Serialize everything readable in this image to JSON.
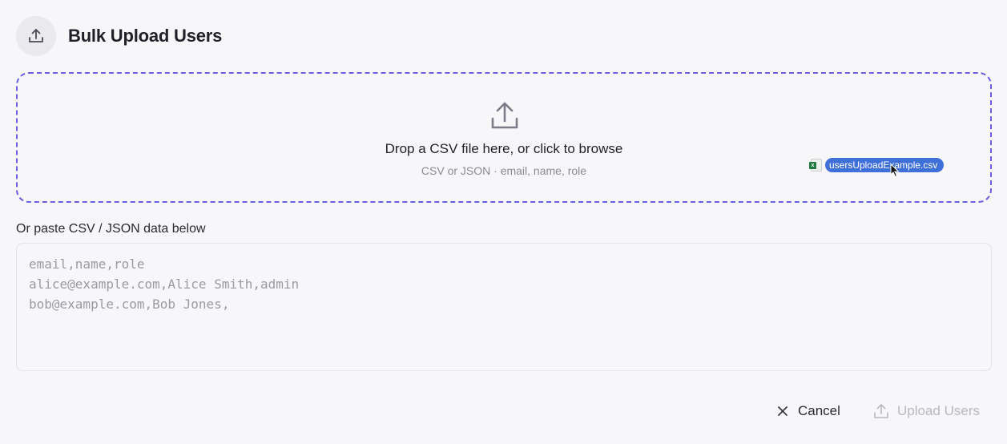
{
  "header": {
    "title": "Bulk Upload Users",
    "icon": "upload-icon"
  },
  "dropzone": {
    "title": "Drop a CSV file here, or click to browse",
    "subtitle": "CSV or JSON · email, name, role",
    "icon": "upload-icon",
    "border_color": "#6a5fe0"
  },
  "drag": {
    "file_name": "usersUploadExample.csv",
    "file_icon": "excel-file-icon",
    "pill_color": "#3f6fd8"
  },
  "paste": {
    "label": "Or paste CSV / JSON data below",
    "placeholder": "email,name,role\nalice@example.com,Alice Smith,admin\nbob@example.com,Bob Jones,"
  },
  "footer": {
    "cancel_label": "Cancel",
    "cancel_icon": "close-icon",
    "upload_label": "Upload Users",
    "upload_icon": "upload-icon",
    "upload_disabled": true
  }
}
